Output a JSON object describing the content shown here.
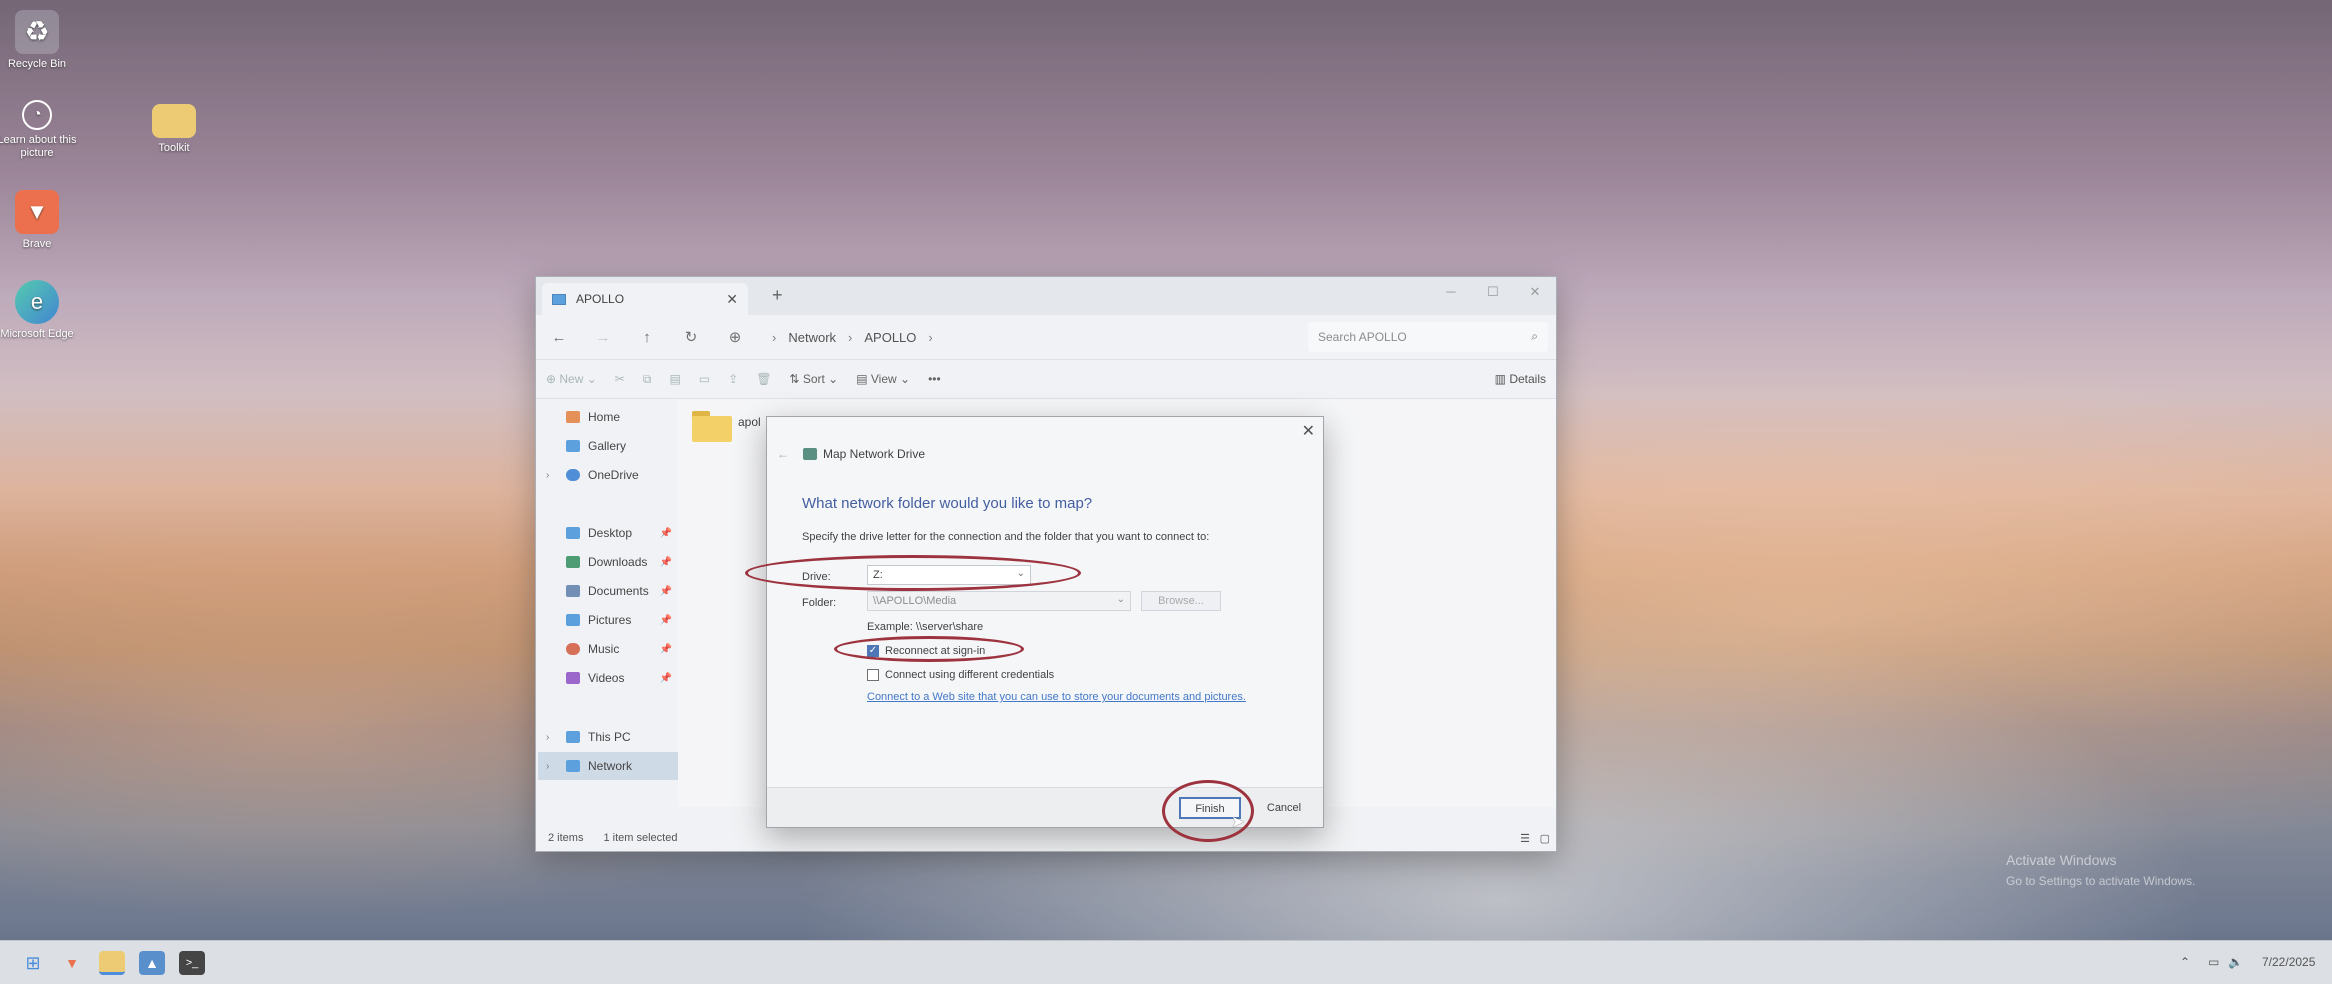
{
  "desktop": {
    "icons": [
      {
        "label": "Recycle Bin",
        "icon": "recycle-bin-icon"
      },
      {
        "label": "Learn about this picture",
        "icon": "camera-info-icon"
      },
      {
        "label": "Toolkit",
        "icon": "folder-icon"
      },
      {
        "label": "Brave",
        "icon": "brave-icon"
      },
      {
        "label": "Microsoft Edge",
        "icon": "edge-icon"
      }
    ],
    "watermark_line1": "Activate Windows",
    "watermark_line2": "Go to Settings to activate Windows."
  },
  "explorer": {
    "tab_title": "APOLLO",
    "breadcrumb": [
      "Network",
      "APOLLO"
    ],
    "search_placeholder": "Search APOLLO",
    "commands": {
      "new": "New",
      "sort": "Sort",
      "view": "View",
      "details": "Details"
    },
    "sidebar": [
      {
        "label": "Home",
        "color": "#e07a3a"
      },
      {
        "label": "Gallery",
        "color": "#3d8fd8"
      },
      {
        "label": "OneDrive",
        "color": "#2f7ad0"
      },
      {
        "label": "Desktop",
        "color": "#3d8fd8"
      },
      {
        "label": "Downloads",
        "color": "#2d8a5a"
      },
      {
        "label": "Documents",
        "color": "#5a7aa8"
      },
      {
        "label": "Pictures",
        "color": "#3d8fd8"
      },
      {
        "label": "Music",
        "color": "#d0553a"
      },
      {
        "label": "Videos",
        "color": "#8a4ac0"
      },
      {
        "label": "This PC",
        "color": "#3d8fd8"
      },
      {
        "label": "Network",
        "color": "#3d8fd8"
      }
    ],
    "folder_item": "apol",
    "status": {
      "items": "2 items",
      "selected": "1 item selected"
    }
  },
  "dialog": {
    "title": "Map Network Drive",
    "heading": "What network folder would you like to map?",
    "intro": "Specify the drive letter for the connection and the folder that you want to connect to:",
    "drive_label": "Drive:",
    "drive_value": "Z:",
    "folder_label": "Folder:",
    "folder_value": "\\\\APOLLO\\Media",
    "browse": "Browse...",
    "example": "Example: \\\\server\\share",
    "reconnect": "Reconnect at sign-in",
    "reconnect_checked": true,
    "different_creds": "Connect using different credentials",
    "different_creds_checked": false,
    "link": "Connect to a Web site that you can use to store your documents and pictures.",
    "finish": "Finish",
    "cancel": "Cancel"
  },
  "taskbar": {
    "date": "7/22/2025"
  },
  "colors": {
    "annotation": "#8b0d1a",
    "accent": "#2b5ea8"
  }
}
